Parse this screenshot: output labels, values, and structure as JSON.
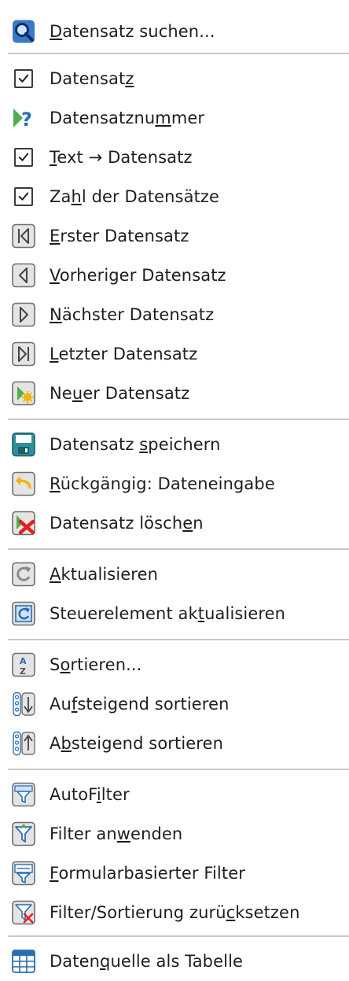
{
  "menu": {
    "items": [
      {
        "label": "Datensatz suchen...",
        "mnemonic": 0,
        "icon": "magnifier-icon",
        "checkable": false
      },
      {
        "label": "Datensatz",
        "mnemonic": 8,
        "icon": "checkbox-icon",
        "checkable": true,
        "checked": true
      },
      {
        "label": "Datensatznummer",
        "mnemonic": 11,
        "icon": "record-number-icon",
        "checkable": false
      },
      {
        "label": "Text → Datensatz",
        "mnemonic": 0,
        "icon": "checkbox-icon",
        "checkable": true,
        "checked": true
      },
      {
        "label": "Zahl der Datensätze",
        "mnemonic": 2,
        "icon": "checkbox-icon",
        "checkable": true,
        "checked": true
      },
      {
        "label": "Erster Datensatz",
        "mnemonic": 0,
        "icon": "first-record-icon",
        "checkable": false
      },
      {
        "label": "Vorheriger Datensatz",
        "mnemonic": 0,
        "icon": "previous-record-icon",
        "checkable": false
      },
      {
        "label": "Nächster Datensatz",
        "mnemonic": 0,
        "icon": "next-record-icon",
        "checkable": false
      },
      {
        "label": "Letzter Datensatz",
        "mnemonic": 0,
        "icon": "last-record-icon",
        "checkable": false
      },
      {
        "label": "Neuer Datensatz",
        "mnemonic": 2,
        "icon": "new-record-icon",
        "checkable": false
      },
      {
        "label": "Datensatz speichern",
        "mnemonic": 10,
        "icon": "save-record-icon",
        "checkable": false
      },
      {
        "label": "Rückgängig: Dateneingabe",
        "mnemonic": 0,
        "icon": "undo-icon",
        "checkable": false
      },
      {
        "label": "Datensatz löschen",
        "mnemonic": 15,
        "icon": "delete-record-icon",
        "checkable": false
      },
      {
        "label": "Aktualisieren",
        "mnemonic": 0,
        "icon": "refresh-icon",
        "checkable": false
      },
      {
        "label": "Steuerelement aktualisieren",
        "mnemonic": 16,
        "icon": "refresh-control-icon",
        "checkable": false
      },
      {
        "label": "Sortieren...",
        "mnemonic": 1,
        "icon": "sort-dialog-icon",
        "checkable": false
      },
      {
        "label": "Aufsteigend sortieren",
        "mnemonic": 2,
        "icon": "sort-ascending-icon",
        "checkable": false
      },
      {
        "label": "Absteigend sortieren",
        "mnemonic": 1,
        "icon": "sort-descending-icon",
        "checkable": false
      },
      {
        "label": "AutoFilter",
        "mnemonic": 5,
        "icon": "autofilter-icon",
        "checkable": false
      },
      {
        "label": "Filter anwenden",
        "mnemonic": 9,
        "icon": "apply-filter-icon",
        "checkable": false
      },
      {
        "label": "Formularbasierter Filter",
        "mnemonic": 0,
        "icon": "form-filter-icon",
        "checkable": false
      },
      {
        "label": "Filter/Sortierung zurücksetzen",
        "mnemonic": 22,
        "icon": "reset-filter-icon",
        "checkable": false
      },
      {
        "label": "Datenquelle als Tabelle",
        "mnemonic": 5,
        "icon": "datasource-table-icon",
        "checkable": false
      }
    ]
  },
  "colors": {
    "separator": "#c9c9c9",
    "text": "#1e1e1e",
    "icon_frame": "#6e6e6e",
    "icon_bg": "#e4e4e4",
    "accent_blue": "#2b6cb3",
    "accent_green": "#4caf50",
    "accent_red": "#e02020",
    "accent_yellow": "#f2b600"
  }
}
